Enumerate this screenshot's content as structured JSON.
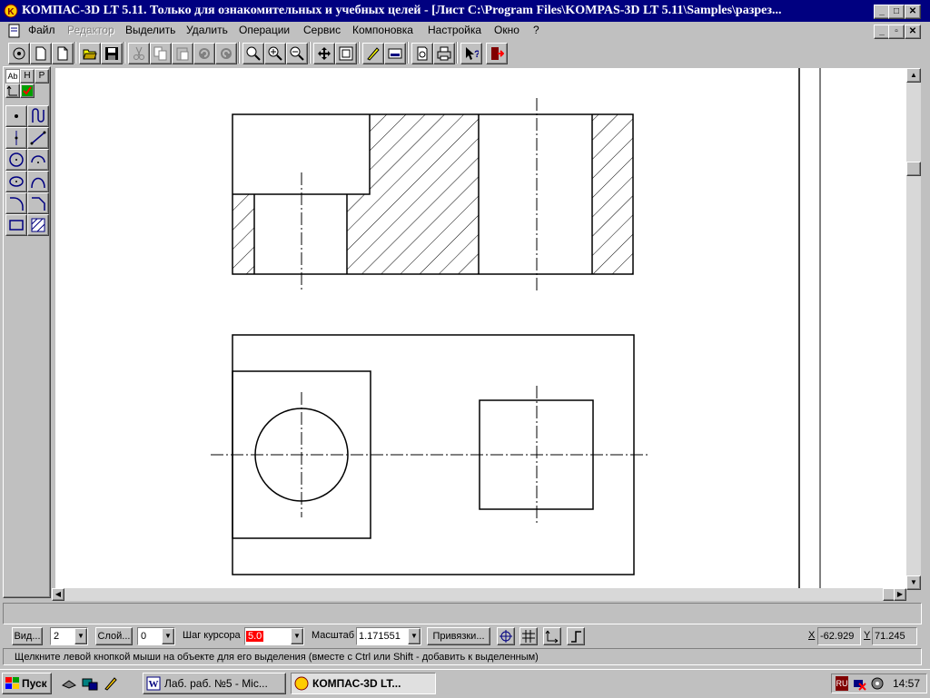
{
  "window": {
    "title": "КОМПАС-3D LT 5.11. Только для ознакомительных и учебных целей - [Лист C:\\Program Files\\KOMPAS-3D LT 5.11\\Samples\\разрез..."
  },
  "menu": {
    "items": [
      "Файл",
      "Редактор",
      "Выделить",
      "Удалить",
      "Операции",
      "Сервис",
      "Компоновка",
      "Настройка",
      "Окно",
      "?"
    ],
    "disabled_index": 1
  },
  "toolbar": {
    "icons": [
      "setup-icon",
      "new-sheet-icon",
      "new-fragment-icon",
      "open-icon",
      "save-icon",
      "cut-icon",
      "copy-icon",
      "paste-icon",
      "undo-icon",
      "redo-icon",
      "zoom-window-icon",
      "zoom-in-icon",
      "zoom-out-icon",
      "pan-icon",
      "zoom-all-icon",
      "redraw-icon",
      "properties-icon",
      "print-preview-icon",
      "print-icon",
      "context-help-icon",
      "exit-icon"
    ]
  },
  "left_panel": {
    "tab_labels": [
      "Ab",
      "H",
      "P"
    ]
  },
  "status": {
    "view_button": "Вид...",
    "view_value": "2",
    "layer_button": "Слой...",
    "layer_value": "0",
    "cursor_step_label": "Шаг курсора",
    "cursor_step_value": "5.0",
    "scale_label": "Масштаб",
    "scale_value": "1.171551",
    "snaps_button": "Привязки...",
    "x_label": "X",
    "x_value": "-62.929",
    "y_label": "Y",
    "y_value": "71.245",
    "hint": "Щелкните левой кнопкой мыши на объекте для его выделения (вместе с Ctrl или Shift - добавить к выделенным)"
  },
  "taskbar": {
    "start": "Пуск",
    "tasks": [
      "Лаб. раб. №5 - Mic...",
      "КОМПАС-3D LT..."
    ],
    "lang": "RU",
    "clock": "14:57"
  },
  "colors": {
    "titlebar": "#000080",
    "face": "#c0c0c0",
    "canvas": "#ffffff",
    "step_highlight": "#ff0000"
  }
}
